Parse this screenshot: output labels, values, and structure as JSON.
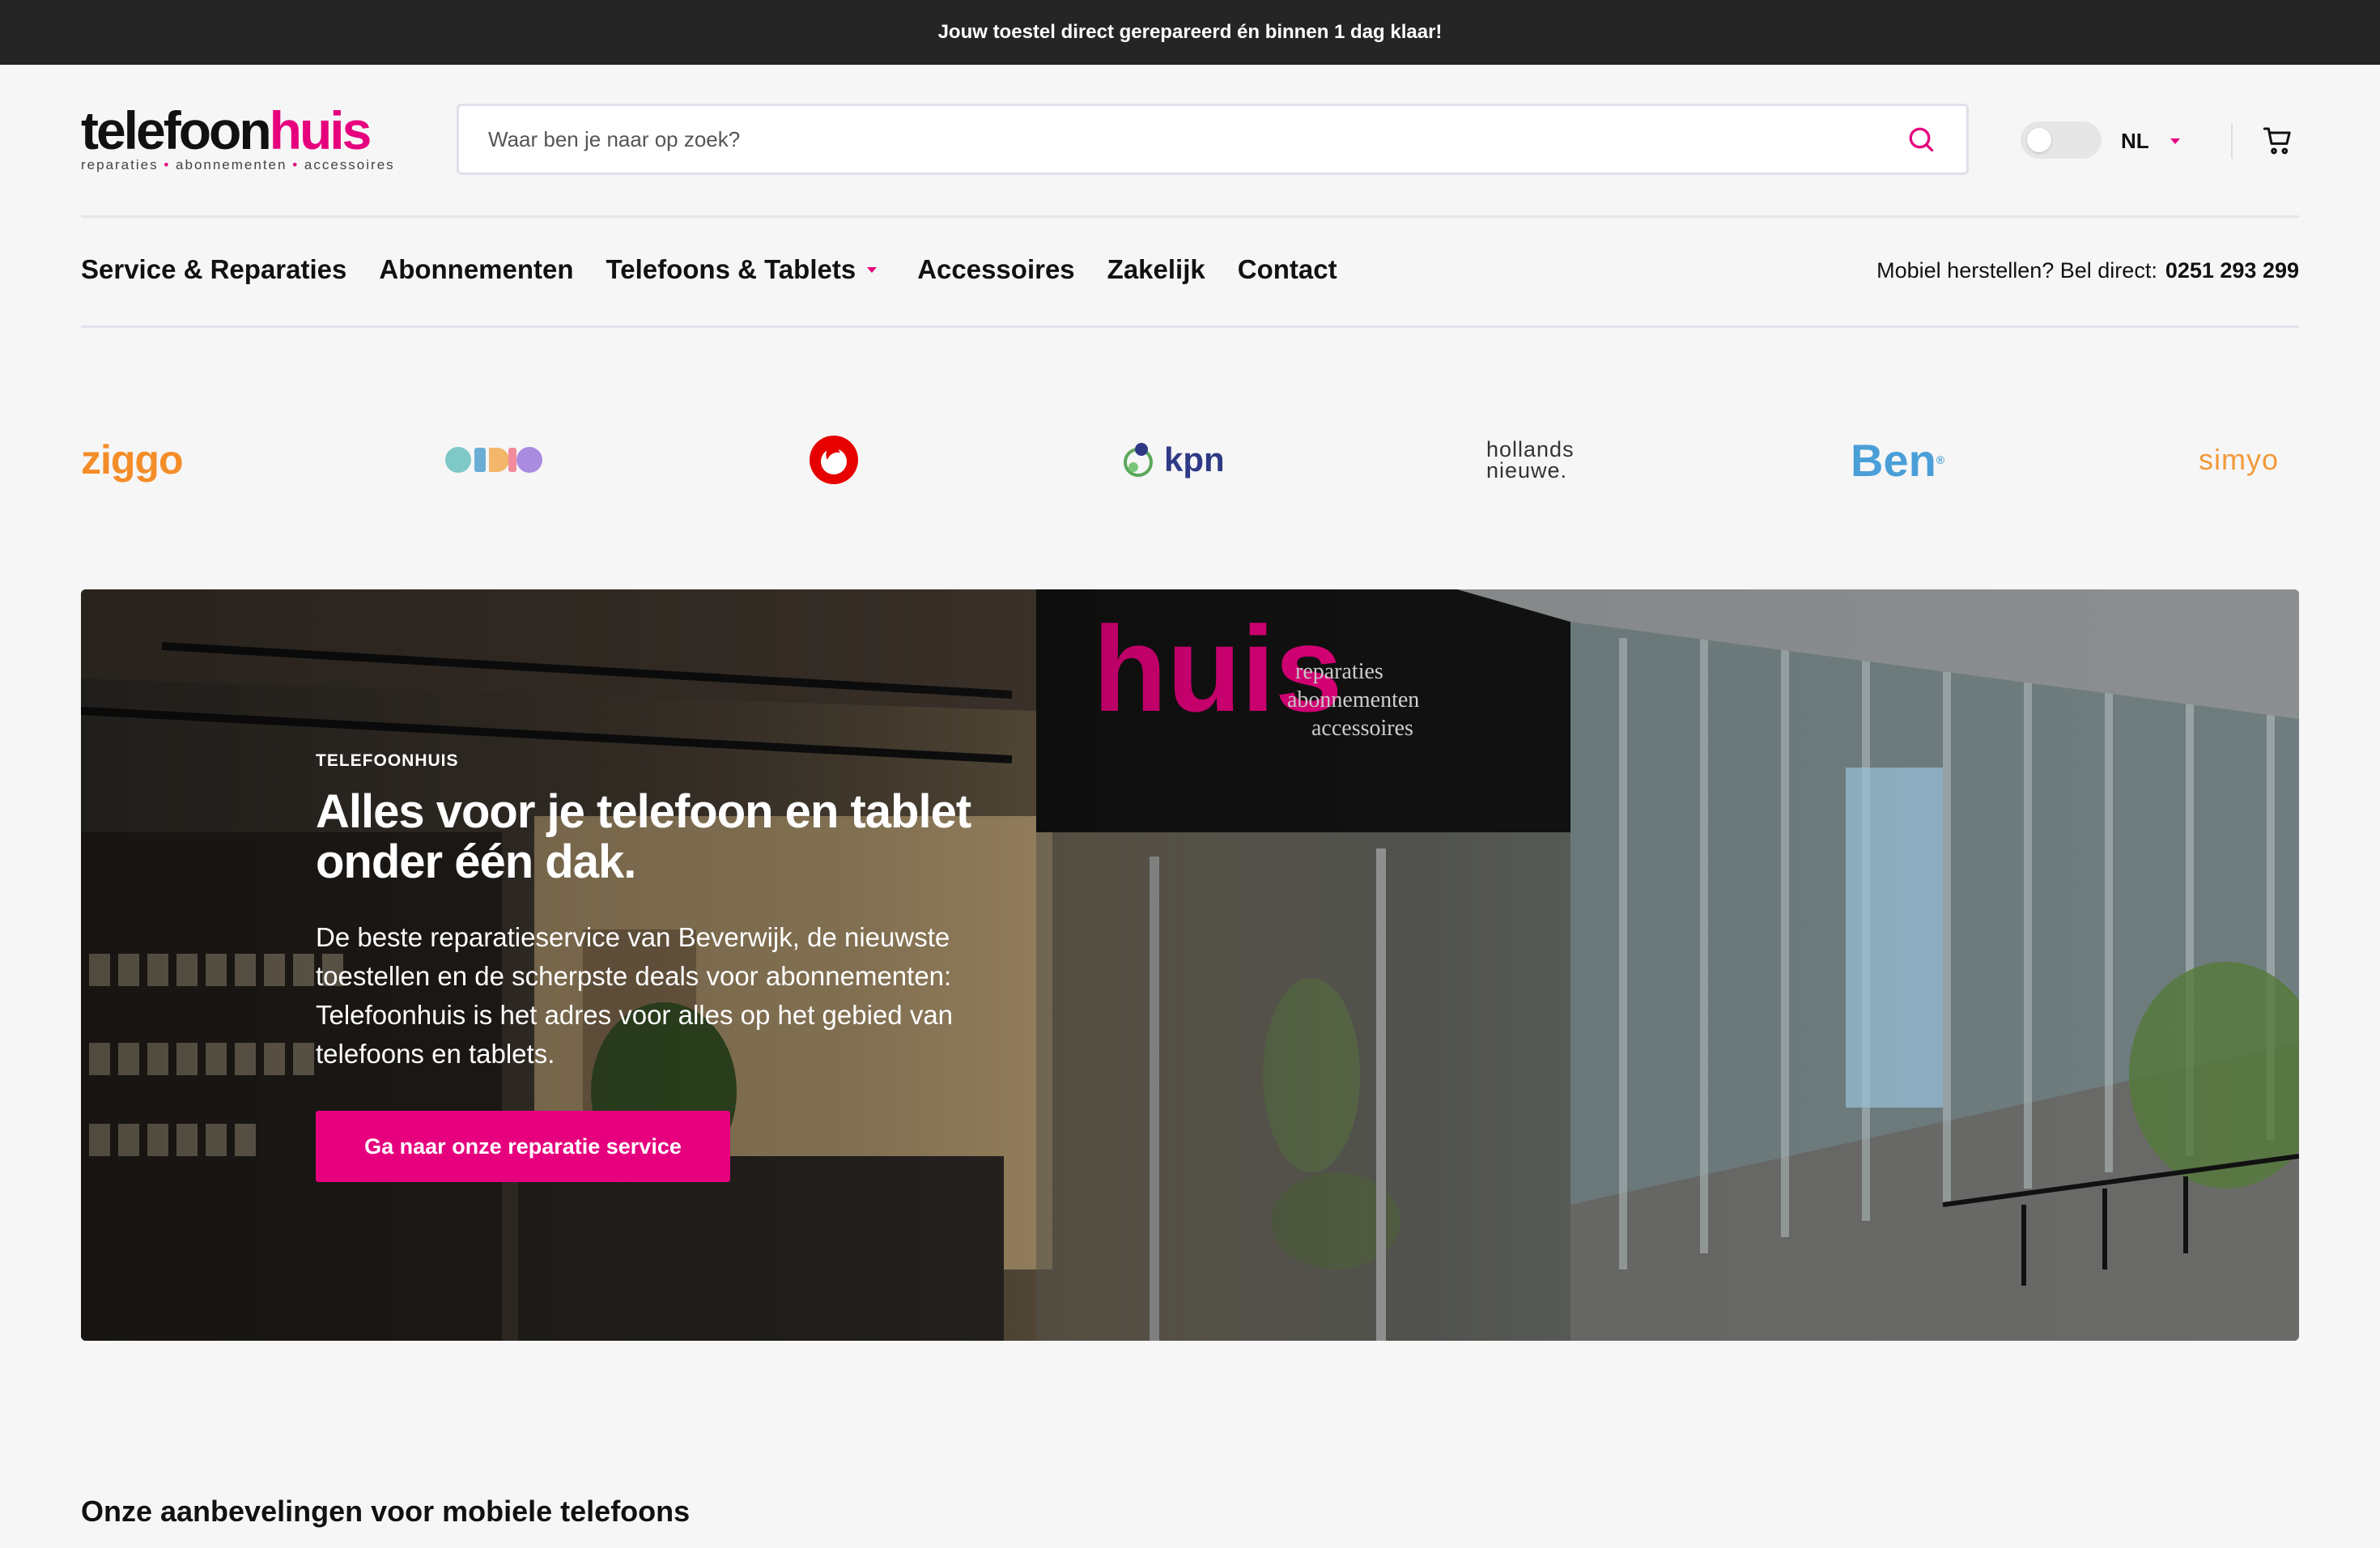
{
  "topbar": {
    "text": "Jouw toestel direct gerepareerd én binnen 1 dag klaar!"
  },
  "logo": {
    "dark": "telefoon",
    "pink": "huis",
    "sub_1": "reparaties",
    "sub_2": "abonnementen",
    "sub_3": "accessoires"
  },
  "search": {
    "placeholder": "Waar ben je naar op zoek?"
  },
  "language": {
    "label": "NL"
  },
  "nav": {
    "items": [
      {
        "label": "Service & Reparaties"
      },
      {
        "label": "Abonnementen"
      },
      {
        "label": "Telefoons & Tablets"
      },
      {
        "label": "Accessoires"
      },
      {
        "label": "Zakelijk"
      },
      {
        "label": "Contact"
      }
    ],
    "phone_label": "Mobiel herstellen? Bel direct:",
    "phone_number": "0251 293 299"
  },
  "partners": {
    "ziggo": "ziggo",
    "kpn": "kpn",
    "hollands_1": "hollands",
    "hollands_2": "nieuwe.",
    "ben": "Ben",
    "simyo": "simyo"
  },
  "hero": {
    "eyebrow": "TELEFOONHUIS",
    "title": "Alles voor je telefoon en tablet onder één dak.",
    "text": "De beste reparatieservice van Beverwijk, de nieuwste toestellen en de scherpste deals voor abonnementen: Telefoonhuis is het adres voor alles op het gebied van telefoons en tablets.",
    "button": "Ga naar onze reparatie service",
    "sign_huis": "huis",
    "sign_sub": "reparaties abonnementen accessoires"
  },
  "section": {
    "title": "Onze aanbevelingen voor mobiele telefoons"
  },
  "colors": {
    "brand_pink": "#e6007e",
    "topbar": "#252525",
    "background": "#f6f6f6"
  },
  "icons": [
    "search-icon",
    "cart-icon",
    "chevron-down-icon",
    "toggle"
  ]
}
